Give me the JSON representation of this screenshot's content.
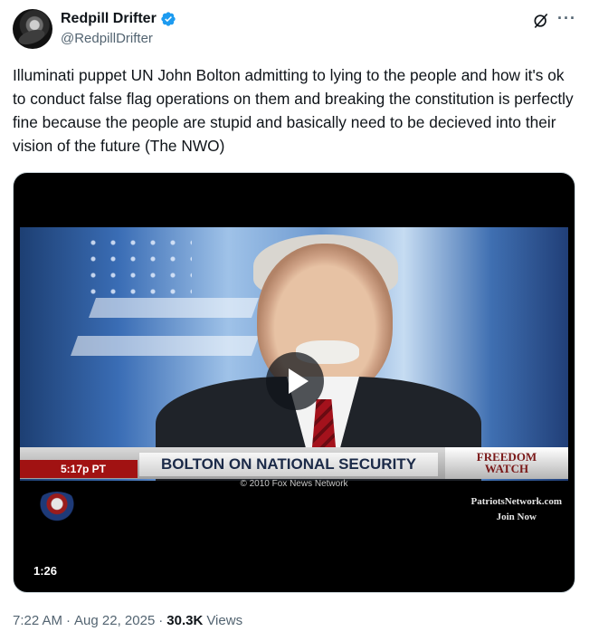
{
  "author": {
    "display_name": "Redpill Drifter",
    "handle": "@RedpillDrifter",
    "verified_color": "#1d9bf0"
  },
  "post": {
    "text": "Illuminati puppet UN John Bolton admitting to lying to the people and how it's ok to conduct false flag operations on them and breaking the constitution is perfectly fine because the people are stupid and basically need to be decieved into their vision of the future (The NWO)"
  },
  "video": {
    "duration": "1:26",
    "time_chip": "5:17p PT",
    "chyron": "BOLTON ON NATIONAL SECURITY",
    "show_logo_line1": "FREEDOM",
    "show_logo_line2": "WATCH",
    "copyright": "© 2010 Fox News Network",
    "promo_line1": "PatriotsNetwork.com",
    "promo_line2": "Join Now"
  },
  "meta": {
    "time": "7:22 AM",
    "separator": "·",
    "date": "Aug 22, 2025",
    "views_count": "30.3K",
    "views_label": "Views"
  },
  "icons": {
    "grok": "grok-icon",
    "more": "more-icon",
    "verified": "verified-badge-icon",
    "play": "play-icon"
  }
}
